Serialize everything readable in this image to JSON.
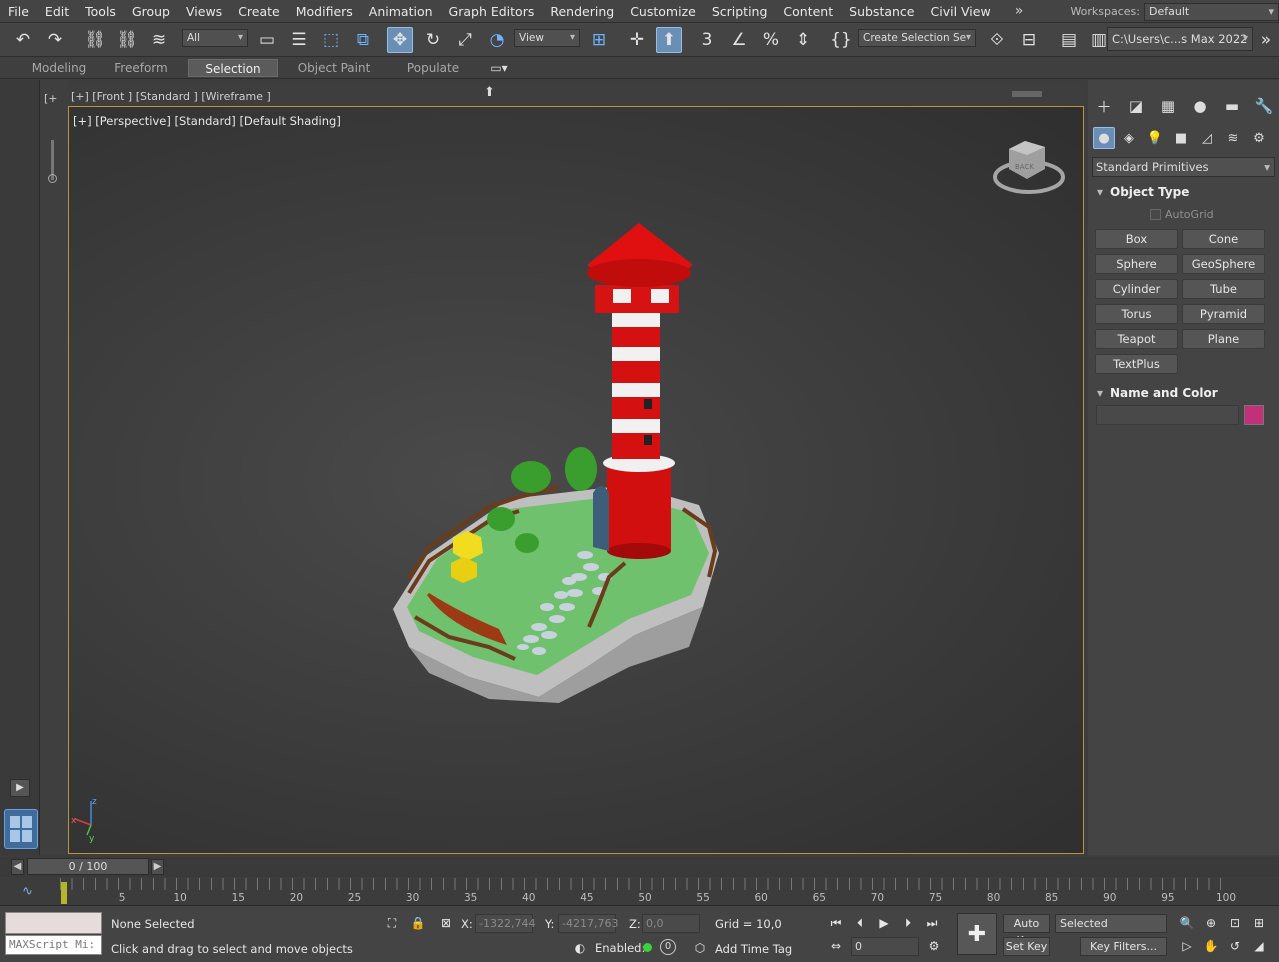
{
  "menu": [
    "File",
    "Edit",
    "Tools",
    "Group",
    "Views",
    "Create",
    "Modifiers",
    "Animation",
    "Graph Editors",
    "Rendering",
    "Customize",
    "Scripting",
    "Content",
    "Substance",
    "Civil View"
  ],
  "workspaces": {
    "label": "Workspaces:",
    "value": "Default"
  },
  "toolbar": {
    "filter": "All",
    "coord_system": "View",
    "selection_set": "Create Selection Se",
    "project_path": "C:\\Users\\c...s Max 2022"
  },
  "ribbon_tabs": [
    "Modeling",
    "Freeform",
    "Selection",
    "Object Paint",
    "Populate"
  ],
  "viewports": {
    "front_label": "[+] [Front ] [Standard ] [Wireframe ]",
    "perspective_label": "[+] [Perspective] [Standard] [Default Shading]",
    "left_strip_label": "[+",
    "viewcube_face": "BACK",
    "axis": {
      "x": "x",
      "y": "y",
      "z": "z"
    }
  },
  "command_panel": {
    "category": "Standard Primitives",
    "object_type_title": "Object Type",
    "autogrid": "AutoGrid",
    "primitives": [
      "Box",
      "Cone",
      "Sphere",
      "GeoSphere",
      "Cylinder",
      "Tube",
      "Torus",
      "Pyramid",
      "Teapot",
      "Plane",
      "TextPlus"
    ],
    "name_color_title": "Name and Color",
    "name_value": "",
    "object_color": "#c2307a"
  },
  "timeline": {
    "frame": "0 / 100",
    "ticks": [
      "5",
      "10",
      "15",
      "20",
      "25",
      "30",
      "35",
      "40",
      "45",
      "50",
      "55",
      "60",
      "65",
      "70",
      "75",
      "80",
      "85",
      "90",
      "95",
      "100"
    ]
  },
  "status": {
    "maxscript_placeholder": "MAXScript Mi:",
    "selection": "None Selected",
    "prompt": "Click and drag to select and move objects",
    "x_label": "X:",
    "x_value": "-1322,744",
    "y_label": "Y:",
    "y_value": "-4217,763",
    "z_label": "Z:",
    "z_value": "0,0",
    "grid": "Grid = 10,0",
    "enabled_label": "Enabled:",
    "enabled_value": "0",
    "add_time_tag": "Add Time Tag",
    "auto_key": "Auto Key",
    "set_key": "Set Key",
    "key_mode": "Selected",
    "key_filters": "Key Filters...",
    "current_frame": "0"
  }
}
